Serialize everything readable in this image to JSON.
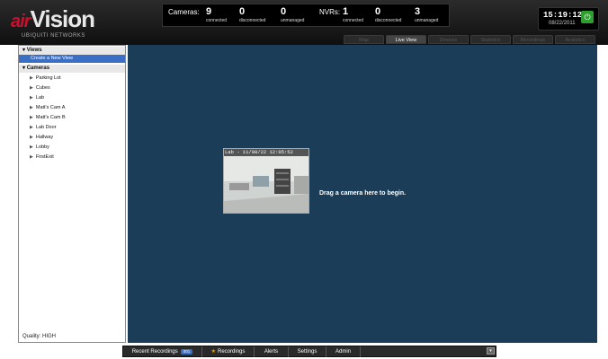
{
  "brand": {
    "logo_text": "airVision",
    "logo_air": "air",
    "logo_rest": "Vision",
    "company": "UBIQUITI NETWORKS"
  },
  "stats": {
    "cameras_label": "Cameras:",
    "cam_connected": "9",
    "cam_connected_label": "connected",
    "cam_disconnected": "0",
    "cam_disconnected_label": "disconnected",
    "cam_unmanaged": "0",
    "cam_unmanaged_label": "unmanaged",
    "nvrs_label": "NVRs:",
    "nvr_connected": "1",
    "nvr_connected_label": "connected",
    "nvr_disconnected": "0",
    "nvr_disconnected_label": "disconnected",
    "nvr_unmanaged": "3",
    "nvr_unmanaged_label": "unmanaged"
  },
  "clock": {
    "time": "15:19:12",
    "date": "08/22/2011"
  },
  "nav": {
    "tabs": [
      "Map",
      "Live View",
      "Devices",
      "Statistics",
      "Recordings",
      "Analytics"
    ],
    "active": "Live View"
  },
  "sidebar": {
    "views_header": "Views",
    "create_view": "Create a New View",
    "cameras_header": "Cameras",
    "cameras": [
      "Parking Lot",
      "Cubes",
      "Lab",
      "Matt's Cam A",
      "Matt's Cam B",
      "Lab Door",
      "Hallway",
      "Lobby",
      "FirstExit"
    ],
    "quality": "Quality: HIGH"
  },
  "main": {
    "thumb_overlay": "Lab - 11/08/22 12:05:52",
    "drag_text": "Drag a camera here to begin."
  },
  "bottom": {
    "recent": "Recent Recordings",
    "recent_count": "001",
    "recordings": "Recordings",
    "alerts": "Alerts",
    "settings": "Settings",
    "admin": "Admin"
  },
  "colors": {
    "accent": "#3a6fc4",
    "main_bg": "#1c3d57",
    "power": "#2e9e2e"
  }
}
